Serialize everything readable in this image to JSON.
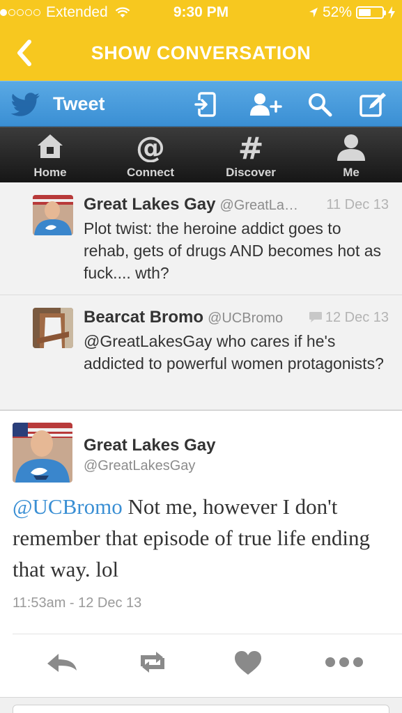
{
  "status_bar": {
    "carrier": "Extended",
    "time": "9:30 PM",
    "battery": "52%",
    "battery_level": 0.52
  },
  "nav": {
    "back_label": "<",
    "title": "SHOW CONVERSATION"
  },
  "twitter_bar": {
    "title": "Tweet",
    "icons": [
      "sign-in-icon",
      "add-user-icon",
      "search-icon",
      "compose-icon"
    ]
  },
  "tabs": [
    {
      "label": "Home",
      "icon": "home-icon"
    },
    {
      "label": "Connect",
      "icon": "at-icon"
    },
    {
      "label": "Discover",
      "icon": "hash-icon"
    },
    {
      "label": "Me",
      "icon": "person-icon"
    }
  ],
  "conversation": [
    {
      "name": "Great Lakes Gay",
      "handle": "@GreatLa…",
      "date": "11 Dec 13",
      "text": "Plot twist: the heroine addict goes to rehab, gets of drugs AND becomes hot as fuck.... wth?"
    },
    {
      "name": "Bearcat Bromo",
      "handle": "@UCBromo",
      "date": "12 Dec 13",
      "text": "@GreatLakesGay who cares if he's addicted to powerful women protagonists?"
    }
  ],
  "main_tweet": {
    "name": "Great Lakes Gay",
    "handle": "@GreatLakesGay",
    "mention": "@UCBromo",
    "text": " Not me, however I don't remember that episode of true life ending that way. lol",
    "timestamp": "11:53am - 12 Dec 13"
  },
  "actions": [
    "reply-icon",
    "retweet-icon",
    "favorite-icon",
    "more-icon"
  ],
  "colors": {
    "header_yellow": "#f7c81f",
    "twitter_blue": "#3a8fd4",
    "tab_dark": "#1e1e1e"
  }
}
